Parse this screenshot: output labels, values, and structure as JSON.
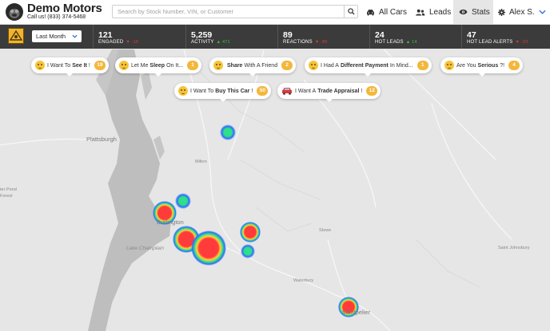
{
  "header": {
    "brand_name": "Demo Motors",
    "brand_sub": "Call us! (833) 374-5468",
    "search_placeholder": "Search by Stock Number, VIN, or Customer",
    "nav": {
      "cars": "All Cars",
      "leads": "Leads",
      "stats": "Stats",
      "user": "Alex S."
    }
  },
  "stats_bar": {
    "range": "Last Month",
    "stats": [
      {
        "value": "121",
        "label": "ENGAGED",
        "delta": "-15",
        "trend": "down"
      },
      {
        "value": "5,259",
        "label": "ACTIVITY",
        "delta": "471",
        "trend": "up"
      },
      {
        "value": "89",
        "label": "REACTIONS",
        "delta": "-85",
        "trend": "down"
      },
      {
        "value": "24",
        "label": "HOT LEADS",
        "delta": "14",
        "trend": "up"
      },
      {
        "value": "47",
        "label": "HOT LEAD ALERTS",
        "delta": "-23",
        "trend": "down"
      }
    ]
  },
  "reactions": [
    {
      "pre": "I Want To",
      "bold": "See It",
      "post": "!",
      "count": "19"
    },
    {
      "pre": "Let Me",
      "bold": "Sleep",
      "post": "On It...",
      "count": "1"
    },
    {
      "pre": "",
      "bold": "Share",
      "post": "With A Friend",
      "count": "2"
    },
    {
      "pre": "I Had A",
      "bold": "Different Payment",
      "post": "In Mind...",
      "count": "1"
    },
    {
      "pre": "Are You",
      "bold": "Serious",
      "post": "?!",
      "count": "4"
    },
    {
      "pre": "I Want To",
      "bold": "Buy This Car",
      "post": "!",
      "count": "50"
    },
    {
      "pre": "I Want A",
      "bold": "Trade Appraisal",
      "post": "!",
      "count": "12"
    }
  ],
  "map": {
    "places": {
      "plattsburgh": "Plattsburgh",
      "milton": "Milton",
      "burlington": "Burlington",
      "lake_champlain": "Lake Champlain",
      "stowe": "Stowe",
      "waterbury": "Waterbury",
      "montpelier": "Montpelier",
      "saint_johnsbury": "Saint Johnsbury",
      "ter_pond": "ter Pond",
      "forest": "Forest"
    }
  },
  "colors": {
    "header_bg": "#ffffff",
    "stats_bg": "#3b3b3b",
    "count_badge": "#f3b73a",
    "positive": "#3cc040",
    "negative": "#e23a3a",
    "heat_hot": "#ff3b3b",
    "heat_mid": "#2ee08a",
    "heat_cool": "#2f6bff"
  },
  "icons": {
    "logo": "gorilla-logo-icon",
    "search": "search-icon",
    "cars": "car-icon",
    "leads": "users-icon",
    "stats": "eye-icon",
    "settings": "gear-icon",
    "chevron": "chevron-down-icon"
  }
}
